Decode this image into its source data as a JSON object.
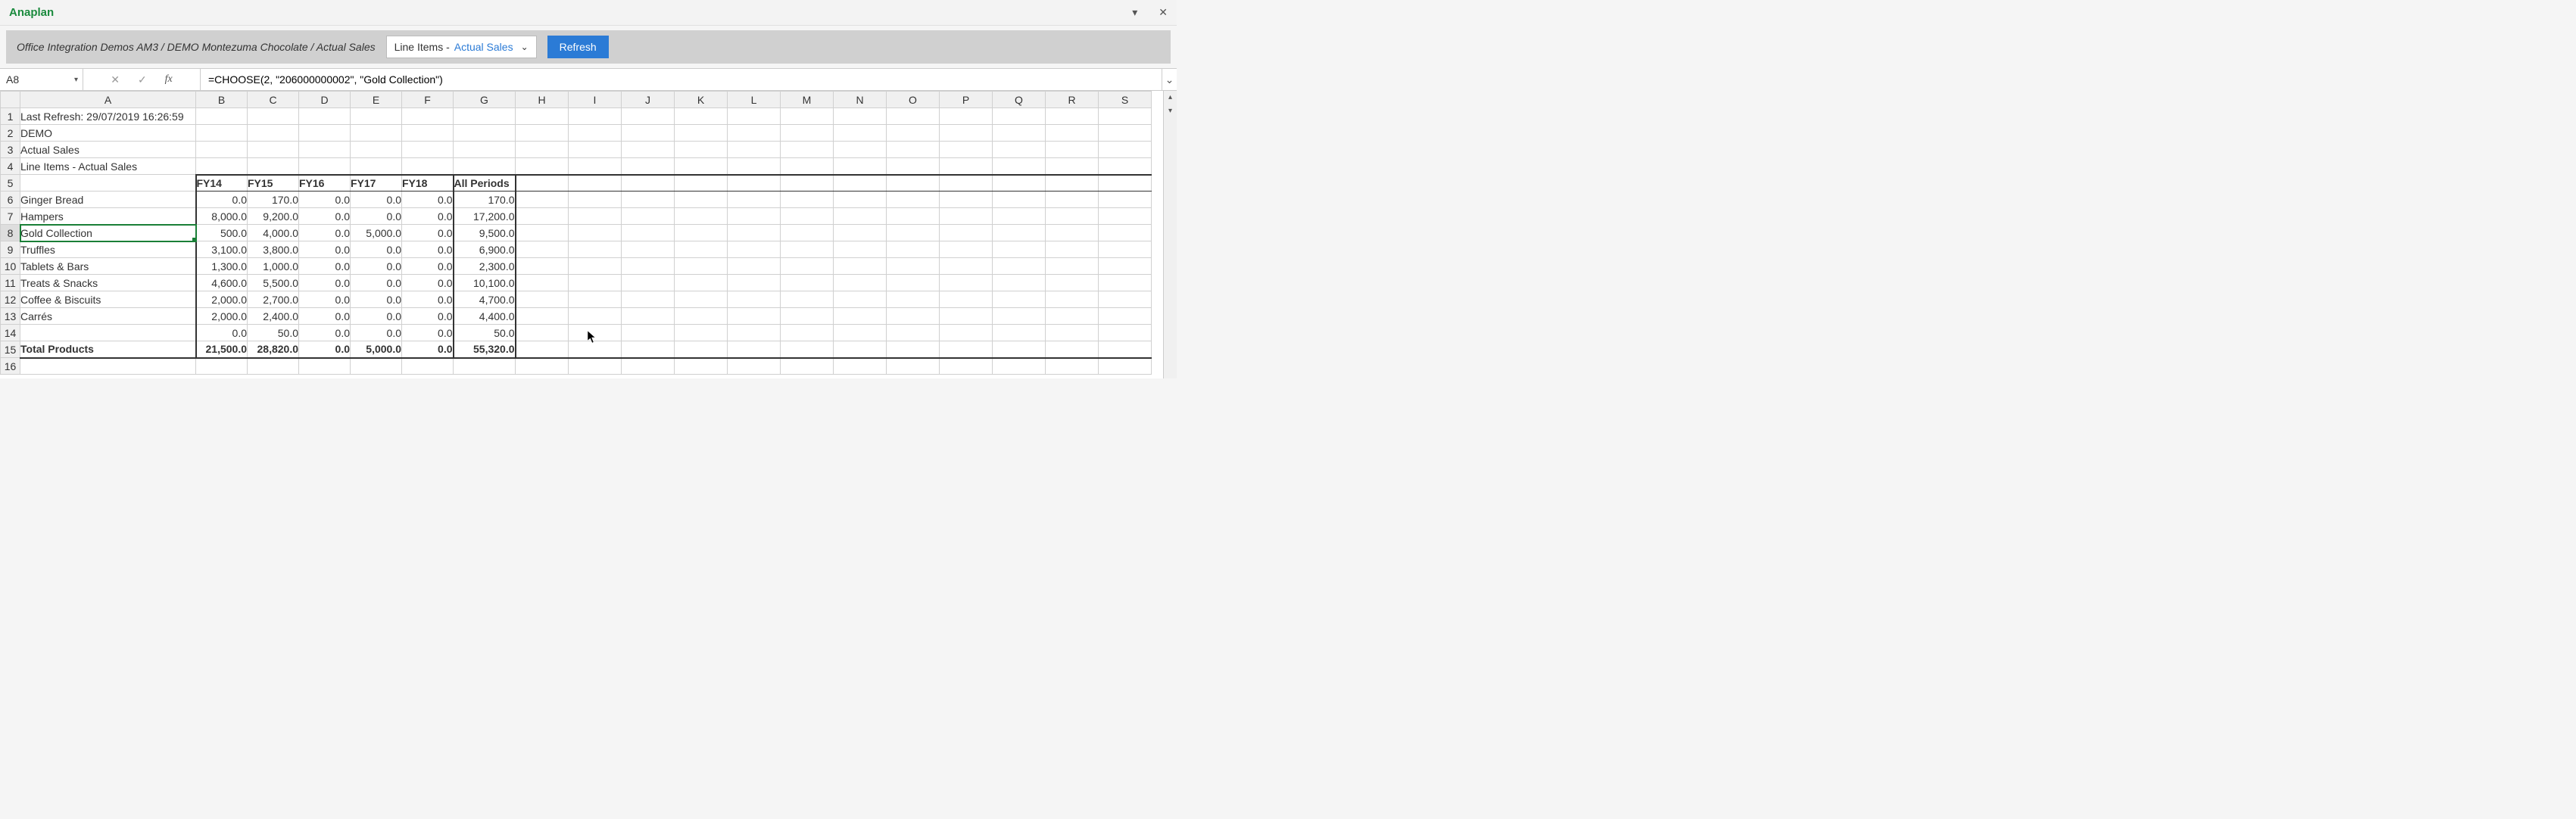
{
  "titlebar": {
    "app": "Anaplan"
  },
  "toolbar": {
    "breadcrumb": "Office Integration Demos AM3 / DEMO Montezuma Chocolate / Actual Sales",
    "dropdown_label": "Line Items - ",
    "dropdown_value": "Actual Sales",
    "refresh": "Refresh"
  },
  "formula_bar": {
    "cell_ref": "A8",
    "formula": "=CHOOSE(2, \"206000000002\", \"Gold Collection\")"
  },
  "columns": [
    "A",
    "B",
    "C",
    "D",
    "E",
    "F",
    "G",
    "H",
    "I",
    "J",
    "K",
    "L",
    "M",
    "N",
    "O",
    "P",
    "Q",
    "R",
    "S"
  ],
  "info_rows": [
    "Last Refresh: 29/07/2019 16:26:59",
    "DEMO",
    "Actual Sales",
    "Line Items - Actual Sales"
  ],
  "header": [
    "FY14",
    "FY15",
    "FY16",
    "FY17",
    "FY18",
    "All Periods"
  ],
  "rows": [
    {
      "label": "Ginger Bread",
      "vals": [
        "0.0",
        "170.0",
        "0.0",
        "0.0",
        "0.0",
        "170.0"
      ]
    },
    {
      "label": "Hampers",
      "vals": [
        "8,000.0",
        "9,200.0",
        "0.0",
        "0.0",
        "0.0",
        "17,200.0"
      ]
    },
    {
      "label": "Gold Collection",
      "vals": [
        "500.0",
        "4,000.0",
        "0.0",
        "5,000.0",
        "0.0",
        "9,500.0"
      ]
    },
    {
      "label": "Truffles",
      "vals": [
        "3,100.0",
        "3,800.0",
        "0.0",
        "0.0",
        "0.0",
        "6,900.0"
      ]
    },
    {
      "label": "Tablets & Bars",
      "vals": [
        "1,300.0",
        "1,000.0",
        "0.0",
        "0.0",
        "0.0",
        "2,300.0"
      ]
    },
    {
      "label": "Treats & Snacks",
      "vals": [
        "4,600.0",
        "5,500.0",
        "0.0",
        "0.0",
        "0.0",
        "10,100.0"
      ]
    },
    {
      "label": "Coffee & Biscuits",
      "vals": [
        "2,000.0",
        "2,700.0",
        "0.0",
        "0.0",
        "0.0",
        "4,700.0"
      ]
    },
    {
      "label": "Carrés",
      "vals": [
        "2,000.0",
        "2,400.0",
        "0.0",
        "0.0",
        "0.0",
        "4,400.0"
      ]
    },
    {
      "label": "",
      "vals": [
        "0.0",
        "50.0",
        "0.0",
        "0.0",
        "0.0",
        "50.0"
      ]
    }
  ],
  "total": {
    "label": "Total Products",
    "vals": [
      "21,500.0",
      "28,820.0",
      "0.0",
      "5,000.0",
      "0.0",
      "55,320.0"
    ]
  },
  "selected_row_index": 2
}
